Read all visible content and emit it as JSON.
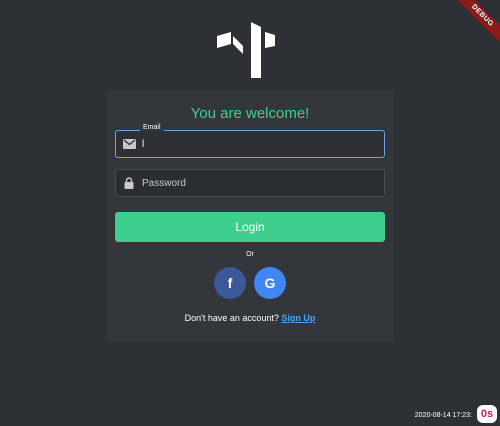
{
  "debug_banner": "DEBUG",
  "logo": {
    "icon": "app-logo"
  },
  "card": {
    "title": "You are welcome!",
    "email": {
      "label": "Email",
      "value": "l",
      "icon": "mail-icon"
    },
    "password": {
      "placeholder": "Password",
      "icon": "lock-icon"
    },
    "login_label": "Login",
    "or_label": "Or",
    "facebook_label": "f",
    "google_label": "G",
    "account_prompt": "Don't have an account?",
    "signup_label": "Sign Up"
  },
  "footer": {
    "timestamp": "2020-08-14 17:23:",
    "badge": "0s"
  },
  "colors": {
    "accent": "#3ecf8e",
    "link": "#4fa3f0",
    "facebook": "#3b5998",
    "google": "#4285f4"
  }
}
